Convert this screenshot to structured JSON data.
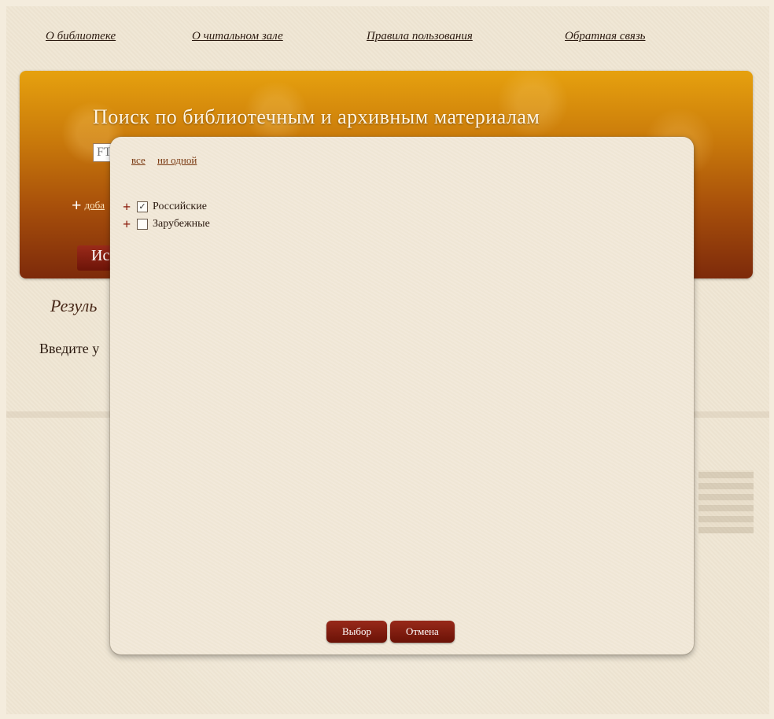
{
  "nav": {
    "about": "О библиотеке",
    "reading_room": "О читальном зале",
    "rules": "Правила пользования",
    "feedback": "Обратная связь"
  },
  "banner": {
    "title": "Поиск по библиотечным и архивным материалам",
    "search_value": "FT",
    "add_label": "доба",
    "search_button": "Ис"
  },
  "results": {
    "heading": "Резуль",
    "intro": "Введите у"
  },
  "modal": {
    "select_all": "все",
    "select_none": "ни одной",
    "tree": [
      {
        "label": "Российские",
        "checked": true
      },
      {
        "label": "Зарубежные",
        "checked": false
      }
    ],
    "ok_button": "Выбор",
    "cancel_button": "Отмена"
  },
  "colors": {
    "accent": "#7d2a0b",
    "button": "#6d1408",
    "banner_top": "#e6a10e"
  }
}
